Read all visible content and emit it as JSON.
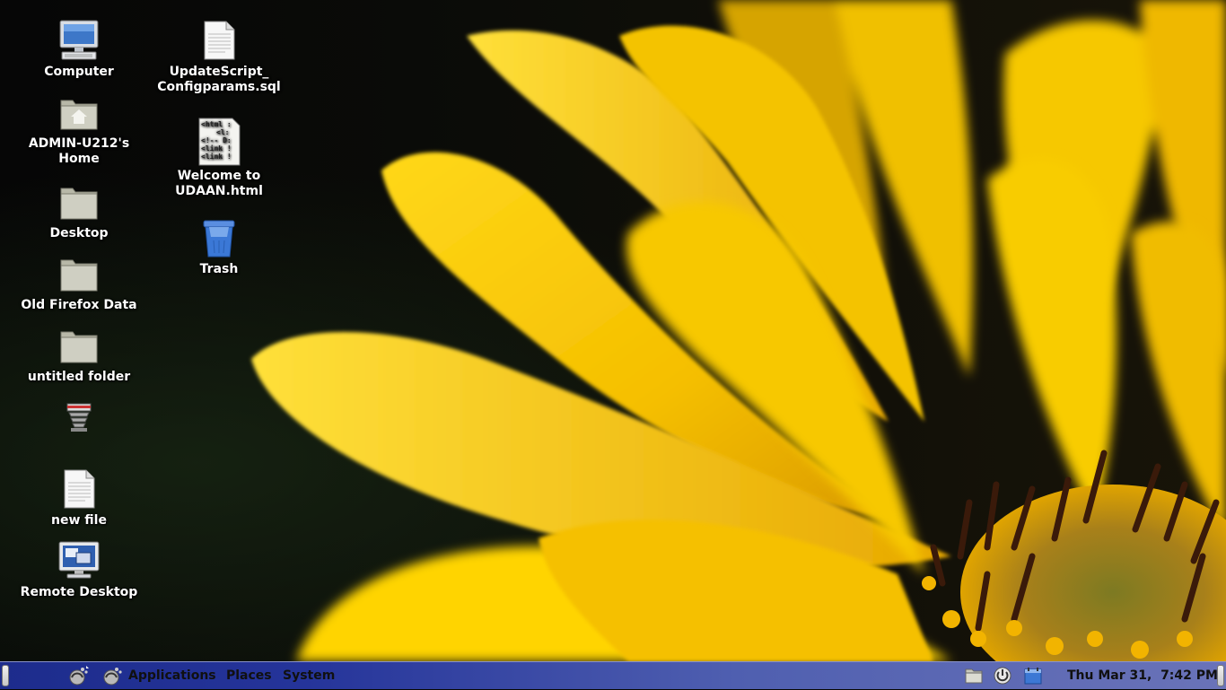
{
  "desktop": {
    "icons": [
      {
        "name": "computer",
        "label": "Computer",
        "icon": "computer-icon"
      },
      {
        "name": "home",
        "label": "ADMIN-U212's\nHome",
        "icon": "home-folder-icon"
      },
      {
        "name": "desktop",
        "label": "Desktop",
        "icon": "folder-icon"
      },
      {
        "name": "old-firefox-data",
        "label": "Old Firefox Data",
        "icon": "folder-icon"
      },
      {
        "name": "untitled-folder",
        "label": "untitled folder",
        "icon": "folder-icon"
      },
      {
        "name": "installer",
        "label": "",
        "icon": "package-installer-icon"
      },
      {
        "name": "new-file",
        "label": "new file",
        "icon": "text-file-icon"
      },
      {
        "name": "remote-desktop",
        "label": "Remote Desktop",
        "icon": "remote-desktop-icon"
      },
      {
        "name": "update-script",
        "label": "UpdateScript_\nConfigparams.sql",
        "icon": "text-file-icon"
      },
      {
        "name": "welcome-html",
        "label": "Welcome to\nUDAAN.html",
        "icon": "html-file-icon"
      },
      {
        "name": "trash",
        "label": "Trash",
        "icon": "trash-icon"
      }
    ]
  },
  "panel": {
    "menus": {
      "applications": "Applications",
      "places": "Places",
      "system": "System"
    },
    "clock": "Thu Mar 31,  7:42 PM",
    "launchers": [
      "gnome-foot-icon",
      "gnome-foot-icon"
    ],
    "tray": [
      "file-manager-icon",
      "power-icon",
      "calendar-icon"
    ]
  },
  "colors": {
    "panel": "#25349a",
    "petal": "#f5c400",
    "wallpaper_dark": "#070806"
  }
}
